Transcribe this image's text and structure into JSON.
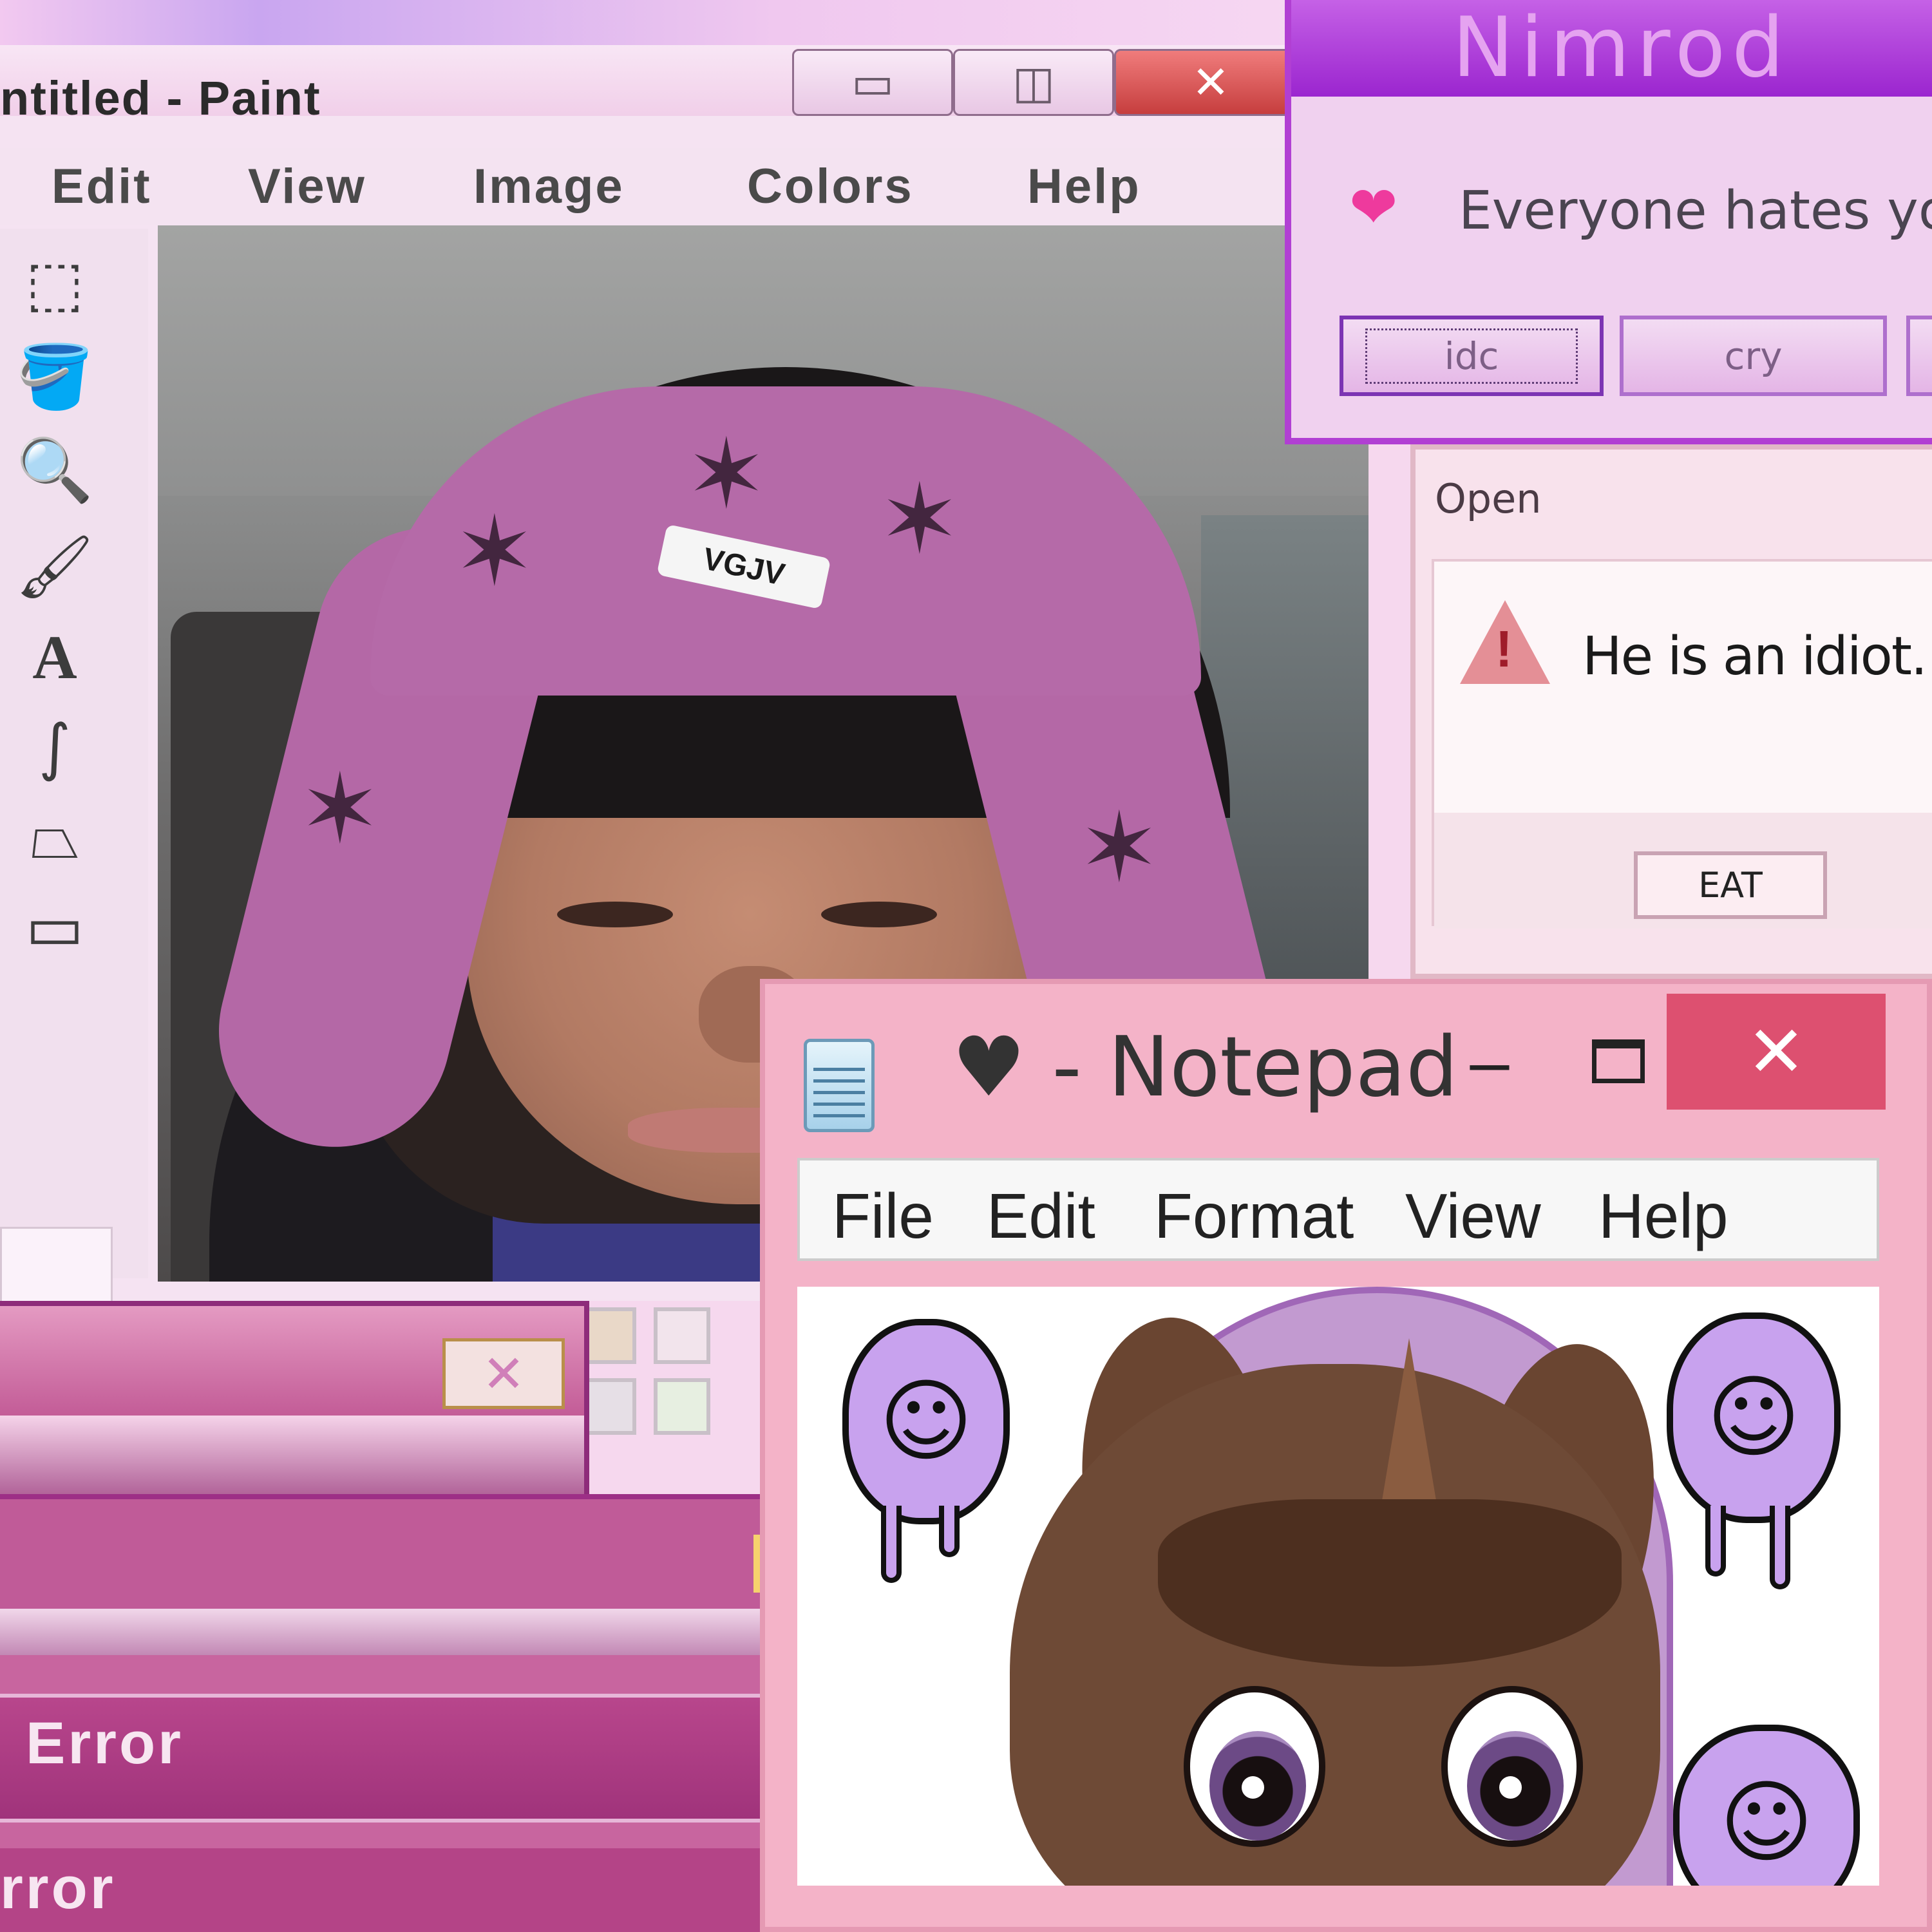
{
  "paint": {
    "title": "ntitled - Paint",
    "window_buttons": {
      "minimize": "▭",
      "maximize": "◫",
      "close": "✕"
    },
    "menu": [
      "Edit",
      "View",
      "Image",
      "Colors",
      "Help"
    ],
    "tools": [
      {
        "icon": "select-rect-icon",
        "glyph": "⬚"
      },
      {
        "icon": "fill-bucket-icon",
        "glyph": "🪣"
      },
      {
        "icon": "magnifier-icon",
        "glyph": "🔍"
      },
      {
        "icon": "brush-icon",
        "glyph": "🖌"
      },
      {
        "icon": "text-tool-icon",
        "glyph": "A"
      },
      {
        "icon": "curve-tool-icon",
        "glyph": "∫"
      },
      {
        "icon": "polygon-tool-icon",
        "glyph": "⏢"
      },
      {
        "icon": "rounded-rect-tool-icon",
        "glyph": "▭"
      }
    ],
    "photo": {
      "beanie_text": "VGJV"
    },
    "palette_colors": [
      "#e9d8c8",
      "#f2e4ec",
      "#e6dfe6",
      "#e7efe1"
    ]
  },
  "errors": {
    "close_glyph": "✕",
    "title_1": "Error",
    "title_2": "rror"
  },
  "nimrod": {
    "title": "Nimrod",
    "icon": "heart-icon",
    "icon_glyph": "❤",
    "message": "Everyone hates you",
    "buttons": [
      "idc",
      "cry",
      ""
    ]
  },
  "open_dialog": {
    "title": "Open",
    "icon": "warning-icon",
    "icon_glyph": "!",
    "message": "He is an idiot. W",
    "button": "EAT"
  },
  "notepad": {
    "title": "♥ - Notepad",
    "icon": "notepad-icon",
    "window_buttons": {
      "minimize": "–",
      "close": "✕"
    },
    "menu": [
      "File",
      "Edit",
      "Format",
      "View",
      "Help"
    ],
    "content": {
      "smiley_face": "☺"
    }
  },
  "colors": {
    "paint_bg": "#f5e3f2",
    "nimrod_title": "#9b25cf",
    "notepad_frame": "#f4b3c8",
    "notepad_close": "#dd5070",
    "error_magenta": "#b8468c",
    "smiley_purple": "#c8a2ee",
    "pony_brown": "#6e4a36"
  }
}
